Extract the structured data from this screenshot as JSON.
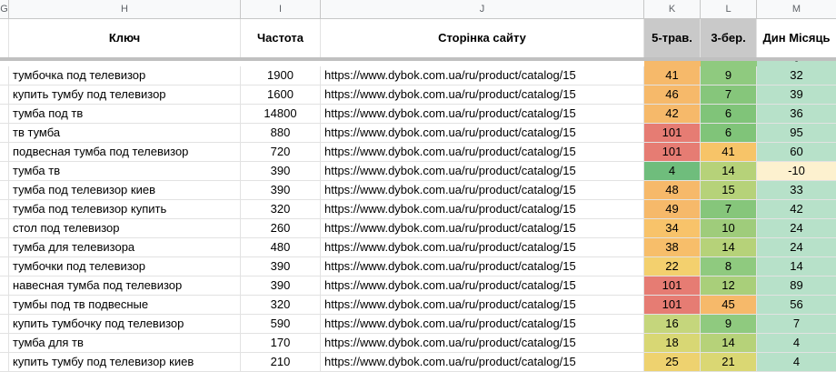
{
  "columns": [
    "G",
    "H",
    "I",
    "J",
    "K",
    "L",
    "M"
  ],
  "headers": {
    "key": "Ключ",
    "freq": "Частота",
    "page": "Сторінка сайту",
    "k": "5-трав.",
    "l": "3-бер.",
    "m": "Дин Місяць"
  },
  "partial_top": {
    "k": "",
    "l": "",
    "m": "-"
  },
  "rows": [
    {
      "key": "тумбочка под телевизор",
      "freq": "1900",
      "url": "https://www.dybok.com.ua/ru/product/catalog/15",
      "k": "41",
      "l": "9",
      "m": "32",
      "kc": "#f6b96a",
      "lc": "#8fca7f",
      "mc": "#b7e1c9"
    },
    {
      "key": "купить тумбу под телевизор",
      "freq": "1600",
      "url": "https://www.dybok.com.ua/ru/product/catalog/15",
      "k": "46",
      "l": "7",
      "m": "39",
      "kc": "#f6b96a",
      "lc": "#86c67b",
      "mc": "#b7e1c9"
    },
    {
      "key": "тумба под тв",
      "freq": "14800",
      "url": "https://www.dybok.com.ua/ru/product/catalog/15",
      "k": "42",
      "l": "6",
      "m": "36",
      "kc": "#f6b96a",
      "lc": "#80c479",
      "mc": "#b7e1c9"
    },
    {
      "key": "тв тумба",
      "freq": "880",
      "url": "https://www.dybok.com.ua/ru/product/catalog/15",
      "k": "101",
      "l": "6",
      "m": "95",
      "kc": "#e67c73",
      "lc": "#80c479",
      "mc": "#b7e1c9"
    },
    {
      "key": "подвесная тумба под телевизор",
      "freq": "720",
      "url": "https://www.dybok.com.ua/ru/product/catalog/15",
      "k": "101",
      "l": "41",
      "m": "60",
      "kc": "#e67c73",
      "lc": "#f7c468",
      "mc": "#b7e1c9"
    },
    {
      "key": "тумба тв",
      "freq": "390",
      "url": "https://www.dybok.com.ua/ru/product/catalog/15",
      "k": "4",
      "l": "14",
      "m": "-10",
      "kc": "#6fbd7c",
      "lc": "#b6d279",
      "mc": "#fdf1cf"
    },
    {
      "key": "тумба под телевизор киев",
      "freq": "390",
      "url": "https://www.dybok.com.ua/ru/product/catalog/15",
      "k": "48",
      "l": "15",
      "m": "33",
      "kc": "#f6b96a",
      "lc": "#b6d279",
      "mc": "#b7e1c9"
    },
    {
      "key": "тумба под телевизор купить",
      "freq": "320",
      "url": "https://www.dybok.com.ua/ru/product/catalog/15",
      "k": "49",
      "l": "7",
      "m": "42",
      "kc": "#f6b96a",
      "lc": "#86c67b",
      "mc": "#b7e1c9"
    },
    {
      "key": "стол под телевизор",
      "freq": "260",
      "url": "https://www.dybok.com.ua/ru/product/catalog/15",
      "k": "34",
      "l": "10",
      "m": "24",
      "kc": "#f8c36a",
      "lc": "#9fcc7b",
      "mc": "#b7e1c9"
    },
    {
      "key": "тумба для телевизора",
      "freq": "480",
      "url": "https://www.dybok.com.ua/ru/product/catalog/15",
      "k": "38",
      "l": "14",
      "m": "24",
      "kc": "#f7be6a",
      "lc": "#b6d279",
      "mc": "#b7e1c9"
    },
    {
      "key": "тумбочки под телевизор",
      "freq": "390",
      "url": "https://www.dybok.com.ua/ru/product/catalog/15",
      "k": "22",
      "l": "8",
      "m": "14",
      "kc": "#f3d06e",
      "lc": "#8fca7f",
      "mc": "#b7e1c9"
    },
    {
      "key": "навесная тумба под телевизор",
      "freq": "390",
      "url": "https://www.dybok.com.ua/ru/product/catalog/15",
      "k": "101",
      "l": "12",
      "m": "89",
      "kc": "#e67c73",
      "lc": "#a9cf7a",
      "mc": "#b7e1c9"
    },
    {
      "key": "тумбы под тв подвесные",
      "freq": "320",
      "url": "https://www.dybok.com.ua/ru/product/catalog/15",
      "k": "101",
      "l": "45",
      "m": "56",
      "kc": "#e67c73",
      "lc": "#f6b96a",
      "mc": "#b7e1c9"
    },
    {
      "key": "купить тумбочку под телевизор",
      "freq": "590",
      "url": "https://www.dybok.com.ua/ru/product/catalog/15",
      "k": "16",
      "l": "9",
      "m": "7",
      "kc": "#c5d67c",
      "lc": "#8fca7f",
      "mc": "#b7e1c9"
    },
    {
      "key": "тумба для тв",
      "freq": "170",
      "url": "https://www.dybok.com.ua/ru/product/catalog/15",
      "k": "18",
      "l": "14",
      "m": "4",
      "kc": "#d8d774",
      "lc": "#b6d279",
      "mc": "#b7e1c9"
    },
    {
      "key": "купить тумбу под телевизор киев",
      "freq": "210",
      "url": "https://www.dybok.com.ua/ru/product/catalog/15",
      "k": "25",
      "l": "21",
      "m": "4",
      "kc": "#eed26f",
      "lc": "#dad773",
      "mc": "#b7e1c9"
    }
  ]
}
